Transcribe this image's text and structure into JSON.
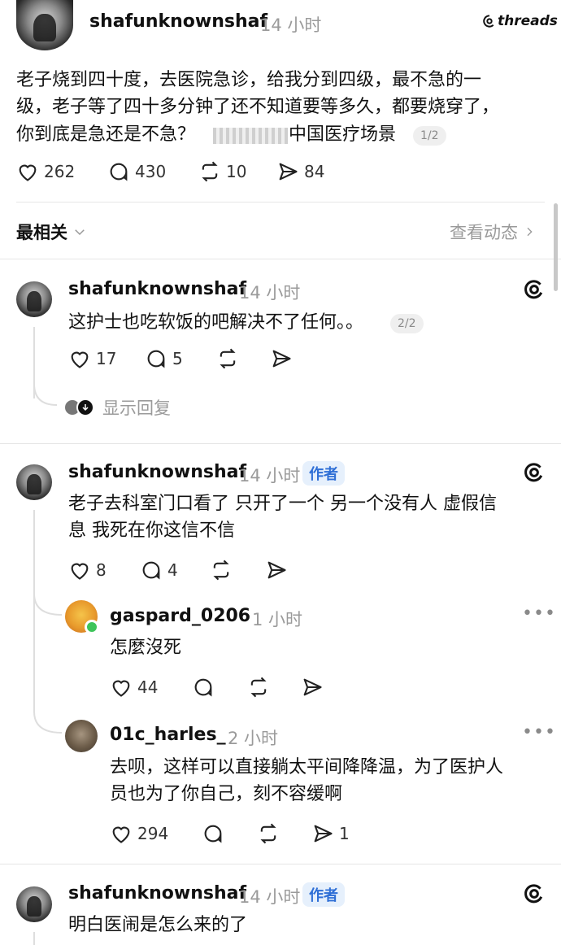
{
  "post": {
    "username": "shafunknownshaf",
    "time": "14 小时",
    "brand": "threads",
    "text_line1": "老子烧到四十度，去医院急诊，给我分到四级，最不急的一",
    "text_line2": "级，老子等了四十多分钟了还不知道要等多久，都要烧穿了，",
    "text_line3a": "你到底是急还是不急？",
    "text_line3b": "中国医疗场景",
    "page_pill": "1/2",
    "likes": "262",
    "replies": "430",
    "reposts": "10",
    "shares": "84"
  },
  "sort": {
    "label": "最相关",
    "view_activity": "查看动态"
  },
  "comments": [
    {
      "username": "shafunknownshaf",
      "time": "14 小时",
      "text_line1": "这护士也吃软饭的吧解决不了任何。。",
      "page_pill": "2/2",
      "likes": "17",
      "replies": "5",
      "show_replies": "显示回复"
    },
    {
      "username": "shafunknownshaf",
      "time": "14 小时",
      "badge": "作者",
      "text_line1": "老子去科室门口看了 只开了一个 另一个没有人 虚假信",
      "text_line2": "息 我死在你这信不信",
      "likes": "8",
      "replies": "4"
    },
    {
      "username": "shafunknownshaf",
      "time": "14 小时",
      "badge": "作者",
      "text_line1": "明白医闹是怎么来的了"
    }
  ],
  "replies": [
    {
      "username": "gaspard_0206",
      "time": "1 小时",
      "text_line1": "怎麼沒死",
      "likes": "44"
    },
    {
      "username": "01c_harles_",
      "time": "2 小时",
      "text_line1": "去呗，这样可以直接躺太平间降降温，为了医护人",
      "text_line2": "员也为了你自己，刻不容缓啊",
      "likes": "294",
      "shares": "1"
    }
  ],
  "colors": {
    "accent_blue": "#2f6fd6",
    "online_green": "#3ec45a",
    "muted_gray": "#9a9a9a"
  }
}
